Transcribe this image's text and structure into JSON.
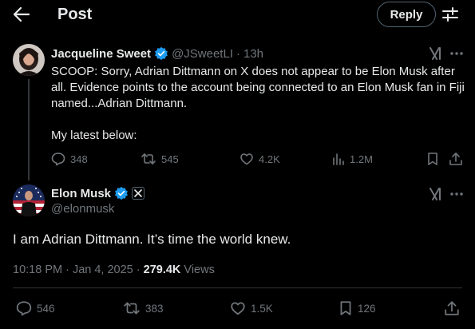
{
  "header": {
    "title": "Post",
    "reply_label": "Reply"
  },
  "colors": {
    "background": "#000000",
    "text": "#e7e9ea",
    "muted": "#71767b",
    "verified_blue": "#1d9bf0",
    "divider": "#2f3336"
  },
  "original_post": {
    "author_name": "Jacqueline Sweet",
    "handle": "@JSweetLI",
    "separator": "·",
    "time": "13h",
    "text_line1": "SCOOP: Sorry, Adrian Dittmann on X does not appear to be Elon Musk after all. Evidence points to the account being connected to an Elon Musk fan in Fiji named...Adrian Dittmann.",
    "text_line2": "My latest below:",
    "stats": {
      "replies": "348",
      "reposts": "545",
      "likes": "4.2K",
      "views": "1.2M"
    }
  },
  "reply_post": {
    "author_name": "Elon Musk",
    "handle": "@elonmusk",
    "text": "I am Adrian Dittmann. It’s time the world knew.",
    "timestamp": "10:18 PM · Jan 4, 2025 · ",
    "views_count": "279.4K",
    "views_label": " Views",
    "stats": {
      "replies": "546",
      "reposts": "383",
      "likes": "1.5K",
      "bookmarks": "126"
    }
  },
  "icons": {
    "back": "arrow-left-icon",
    "settings": "sliders-icon",
    "verified": "verified-badge-icon",
    "grok": "grok-icon",
    "more": "more-horizontal-icon",
    "reply": "reply-bubble-icon",
    "repost": "repost-icon",
    "like": "heart-icon",
    "views": "analytics-bars-icon",
    "bookmark": "bookmark-icon",
    "share": "share-icon",
    "x_affiliation": "x-logo-icon"
  }
}
